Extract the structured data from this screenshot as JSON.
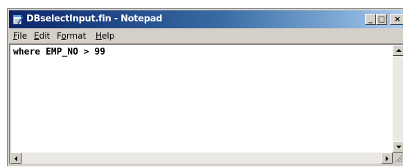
{
  "window": {
    "title": "DBselectInput.fin - Notepad",
    "app_icon": "notepad-icon",
    "controls": {
      "minimize_glyph": "_",
      "maximize_glyph": "□",
      "close_glyph": "×"
    },
    "titlebar_colors": [
      "#0a246a",
      "#3a6ea5",
      "#a6caf0"
    ]
  },
  "menubar": {
    "items": [
      {
        "accel": "F",
        "rest": "ile"
      },
      {
        "accel": "E",
        "rest": "dit"
      },
      {
        "pre": "F",
        "accel": "o",
        "rest": "rmat"
      },
      {
        "accel": "H",
        "rest": "elp"
      }
    ]
  },
  "editor": {
    "content": "where EMP_NO > 99"
  }
}
